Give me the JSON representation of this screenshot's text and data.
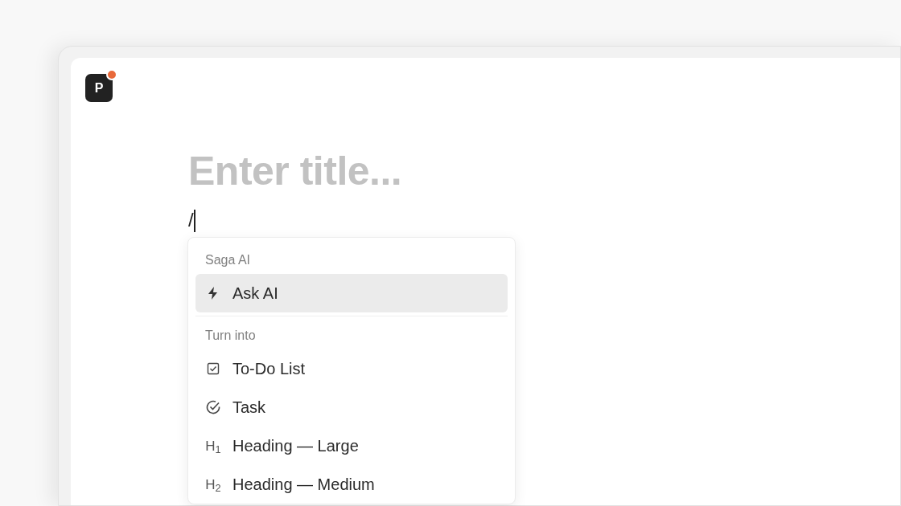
{
  "app_logo": {
    "letter": "P",
    "notification": true
  },
  "editor": {
    "title_placeholder": "Enter title...",
    "body_value": "/"
  },
  "slash_menu": {
    "sections": [
      {
        "label": "Saga AI",
        "items": [
          {
            "kind": "bolt",
            "label": "Ask AI",
            "selected": true
          }
        ]
      },
      {
        "label": "Turn into",
        "items": [
          {
            "kind": "checkbox",
            "label": "To-Do List",
            "selected": false
          },
          {
            "kind": "check-circle",
            "label": "Task",
            "selected": false
          },
          {
            "kind": "text",
            "icon_text": "H$_{1}$",
            "label": "Heading — Large",
            "selected": false
          },
          {
            "kind": "text",
            "icon_text": "H$_{2}$",
            "label": "Heading — Medium",
            "selected": false
          }
        ]
      }
    ]
  }
}
